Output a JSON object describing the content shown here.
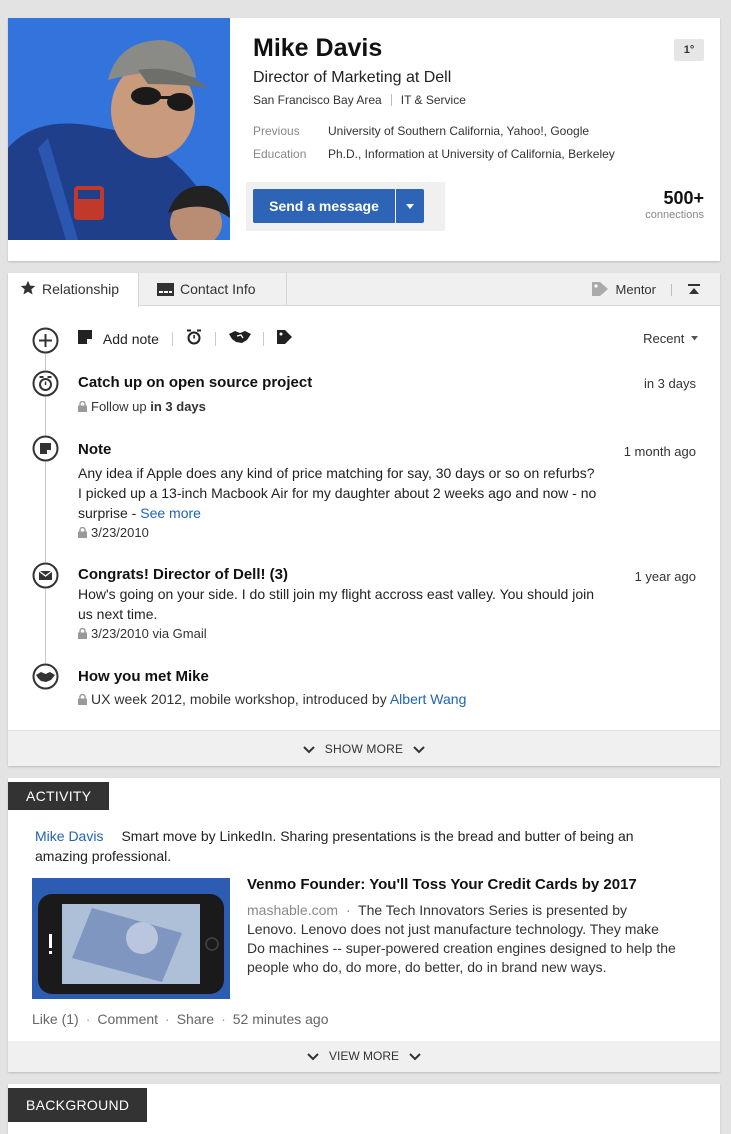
{
  "profile": {
    "name": "Mike Davis",
    "degree": "1°",
    "headline": "Director of Marketing at Dell",
    "location": "San Francisco Bay Area",
    "industry": "IT & Service",
    "previous_label": "Previous",
    "previous_value": "University of Southern California, Yahoo!, Google",
    "education_label": "Education",
    "education_value": "Ph.D., Information at University of California, Berkeley",
    "send_message": "Send a message",
    "connections_count": "500+",
    "connections_label": "connections"
  },
  "relationship": {
    "tabs": [
      "Relationship",
      "Contact Info"
    ],
    "tag": "Mentor",
    "add_note": "Add note",
    "sort": "Recent",
    "items": [
      {
        "title": "Catch up on open source project",
        "time": "in 3 days",
        "sub_prefix": "Follow up ",
        "sub_bold": "in 3 days"
      },
      {
        "title": "Note",
        "time": "1 month ago",
        "body": "Any idea if Apple does any kind of price matching for say, 30 days or so on refurbs? I picked up a 13-inch Macbook Air for my daughter about 2 weeks ago and now - no surprise - ",
        "see_more": "See more",
        "date": "3/23/2010"
      },
      {
        "title": "Congrats! Director of Dell!  (3)",
        "time": "1 year ago",
        "body": "How's going on your side. I do still join my flight accross east valley. You should join us next time.",
        "date": "3/23/2010 via Gmail"
      },
      {
        "title": "How you met Mike",
        "sub": "UX week 2012, mobile workshop, introduced by ",
        "sub_link": "Albert Wang"
      }
    ],
    "show_more": "SHOW MORE"
  },
  "activity": {
    "label": "ACTIVITY",
    "author": "Mike Davis",
    "text": "Smart move by LinkedIn. Sharing presentations is the bread and butter of being an amazing professional.",
    "article_title": "Venmo Founder: You'll Toss Your Credit Cards by 2017",
    "article_source": "mashable.com",
    "article_desc": "The Tech Innovators Series is presented by Lenovo. Lenovo does not just manufacture technology. They make Do machines -- super-powered creation engines designed to help the people who do, do more, do better, do in brand new ways.",
    "like": "Like (1)",
    "comment": "Comment",
    "share": "Share",
    "time": "52 minutes ago",
    "view_more": "VIEW MORE"
  },
  "background": {
    "label": "BACKGROUND"
  },
  "colors": {
    "brand_blue": "#2e64b6",
    "link_blue": "#1f63b5",
    "dark_label": "#333333"
  }
}
